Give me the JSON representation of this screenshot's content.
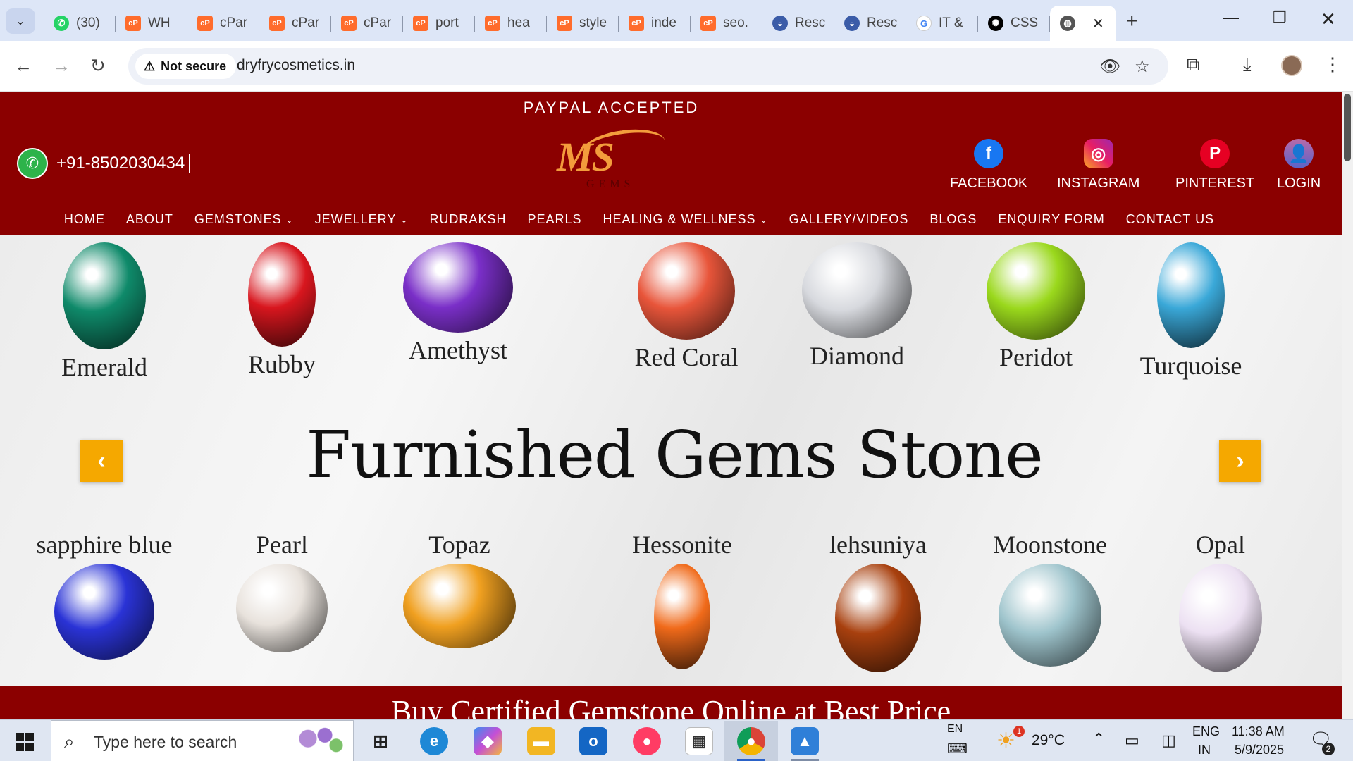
{
  "browser": {
    "tabs": [
      {
        "label": "(30)",
        "icon": "whatsapp-icon",
        "type": "whatsapp"
      },
      {
        "label": "WH",
        "icon": "cpanel-icon",
        "type": "cpanel"
      },
      {
        "label": "cPar",
        "icon": "cpanel-icon",
        "type": "cpanel"
      },
      {
        "label": "cPar",
        "icon": "cpanel-icon",
        "type": "cpanel"
      },
      {
        "label": "cPar",
        "icon": "cpanel-icon",
        "type": "cpanel"
      },
      {
        "label": "port",
        "icon": "cpanel-icon",
        "type": "cpanel"
      },
      {
        "label": "hea",
        "icon": "cpanel-icon",
        "type": "cpanel"
      },
      {
        "label": "style",
        "icon": "cpanel-icon",
        "type": "cpanel"
      },
      {
        "label": "inde",
        "icon": "cpanel-icon",
        "type": "cpanel"
      },
      {
        "label": "seo.",
        "icon": "cpanel-icon",
        "type": "cpanel"
      },
      {
        "label": "Resc",
        "icon": "res-icon",
        "type": "res"
      },
      {
        "label": "Resc",
        "icon": "res-icon",
        "type": "res"
      },
      {
        "label": "IT &",
        "icon": "google-icon",
        "type": "google"
      },
      {
        "label": "CSS",
        "icon": "openai-icon",
        "type": "openai"
      }
    ],
    "security_label": "Not secure",
    "url": "dryfrycosmetics.in"
  },
  "site": {
    "paypal": "PAYPAL ACCEPTED",
    "phone": "+91-8502030434",
    "logo_text": "MS",
    "logo_sub": "GEMS",
    "social": [
      {
        "label": "FACEBOOK",
        "glyph": "f"
      },
      {
        "label": "INSTAGRAM",
        "glyph": "◎"
      },
      {
        "label": "PINTEREST",
        "glyph": "P"
      },
      {
        "label": "LOGIN",
        "glyph": "👤"
      }
    ],
    "menu": [
      {
        "label": "HOME",
        "dropdown": false
      },
      {
        "label": "ABOUT",
        "dropdown": false
      },
      {
        "label": "GEMSTONES",
        "dropdown": true
      },
      {
        "label": "JEWELLERY",
        "dropdown": true
      },
      {
        "label": "RUDRAKSH",
        "dropdown": false
      },
      {
        "label": "PEARLS",
        "dropdown": false
      },
      {
        "label": "HEALING & WELLNESS",
        "dropdown": true
      },
      {
        "label": "GALLERY/VIDEOS",
        "dropdown": false
      },
      {
        "label": "BLOGS",
        "dropdown": false
      },
      {
        "label": "ENQUIRY FORM",
        "dropdown": false
      },
      {
        "label": "CONTACT US",
        "dropdown": false
      }
    ],
    "banner": {
      "headline": "Furnished Gems Stone",
      "top_gems": [
        {
          "name": "Emerald",
          "color": "#0f8a6a"
        },
        {
          "name": "Rubby",
          "color": "#d8161e"
        },
        {
          "name": "Amethyst",
          "color": "#7a2fc8"
        },
        {
          "name": "Red Coral",
          "color": "#e8553a"
        },
        {
          "name": "Diamond",
          "color": "#d7d9de"
        },
        {
          "name": "Peridot",
          "color": "#9ad81c"
        },
        {
          "name": "Turquoise",
          "color": "#3aa8d8"
        }
      ],
      "bottom_gems": [
        {
          "name": "sapphire blue",
          "color": "#2a33d6"
        },
        {
          "name": "Pearl",
          "color": "#e8e2dc"
        },
        {
          "name": "Topaz",
          "color": "#f0a020"
        },
        {
          "name": "Hessonite",
          "color": "#f06a1a"
        },
        {
          "name": "lehsuniya",
          "color": "#a8400e"
        },
        {
          "name": "Moonstone",
          "color": "#9ec4cc"
        },
        {
          "name": "Opal",
          "color": "#ece0f2"
        }
      ]
    },
    "strip_text": "Buy Certified Gemstone Online at Best Price"
  },
  "taskbar": {
    "search_placeholder": "Type here to search",
    "weather": "29°C",
    "weather_badge": "1",
    "lang_top": "EN",
    "lang": "ENG",
    "region": "IN",
    "time": "11:38 AM",
    "date": "5/9/2025",
    "notifications": "2"
  },
  "colors": {
    "brand_red": "#8b0000",
    "arrow_yellow": "#f5a800",
    "logo_orange": "#f39c3c"
  }
}
